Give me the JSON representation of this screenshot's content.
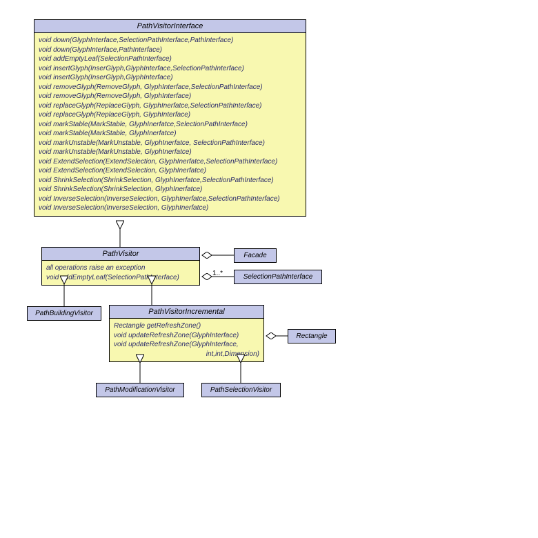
{
  "pvi": {
    "title": "PathVisitorInterface",
    "ops": [
      "void down(GlyphInterface,SelectionPathInterface,PathInterface)",
      "void down(GlyphInterface,PathInterface)",
      "void addEmptyLeaf(SelectionPathInterface)",
      "void insertGlyph(InserGlyph,GlyphInterface,SelectionPathInterface)",
      "void insertGlyph(InserGlyph,GlyphInterface)",
      "void removeGlyph(RemoveGlyph, GlyphInterface,SelectionPathInterface)",
      "void removeGlyph(RemoveGlyph, GlyphInterface)",
      "void replaceGlyph(ReplaceGlyph, GlyphInerfatce,SelectionPathInterface)",
      "void replaceGlyph(ReplaceGlyph, GlyphInterface)",
      "void markStable(MarkStable, GlyphInerfatce,SelectionPathInterface)",
      "void markStable(MarkStable, GlyphInerfatce)",
      "void markUnstable(MarkUnstable, GlyphInerfatce, SelectionPathInterface)",
      "void markUnstable(MarkUnstable, GlyphInerfatce)",
      "void ExtendSelection(ExtendSelection, GlyphInerfatce,SelectionPathInterface)",
      "void ExtendSelection(ExtendSelection, GlyphInerfatce)",
      "void ShrinkSelection(ShrinkSelection, GlyphInerfatce,SelectionPathInterface)",
      "void ShrinkSelection(ShrinkSelection, GlyphInerfatce)",
      "void InverseSelection(InverseSelection, GlyphInerfatce,SelectionPathInterface)",
      "void InverseSelection(InverseSelection, GlyphInerfatce)"
    ]
  },
  "pv": {
    "title": "PathVisitor",
    "line1": "all operations raise an exception",
    "line2": "void addEmptyLeaf(SelectionPathInterface)"
  },
  "pvinc": {
    "title": "PathVisitorIncremental",
    "line1": "Rectangle getRefreshZone()",
    "line2": "void updateRefreshZone(GlyphInterface)",
    "line3": "void updateRefreshZone(GlyphInterface,",
    "line4": "int,int,Dimension)"
  },
  "boxes": {
    "facade": "Facade",
    "spi": "SelectionPathInterface",
    "rect": "Rectangle",
    "pbv": "PathBuildingVisitor",
    "pmv": "PathModificationVisitor",
    "psv": "PathSelectionVisitor"
  },
  "mult": "1..*"
}
